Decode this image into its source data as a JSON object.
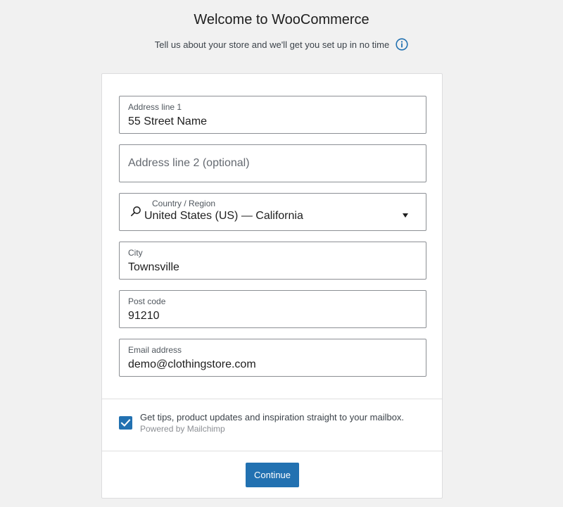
{
  "header": {
    "title": "Welcome to WooCommerce",
    "subtitle": "Tell us about your store and we'll get you set up in no time",
    "info_icon": "info-icon"
  },
  "form": {
    "address1": {
      "label": "Address line 1",
      "value": "55 Street Name"
    },
    "address2": {
      "placeholder": "Address line 2 (optional)",
      "value": ""
    },
    "country": {
      "label": "Country / Region",
      "value": "United States (US) — California",
      "icon": "search-icon"
    },
    "city": {
      "label": "City",
      "value": "Townsville"
    },
    "postcode": {
      "label": "Post code",
      "value": "91210"
    },
    "email": {
      "label": "Email address",
      "value": "demo@clothingstore.com"
    }
  },
  "optin": {
    "checked": true,
    "text": "Get tips, product updates and inspiration straight to your mailbox.",
    "powered_by": "Powered by Mailchimp"
  },
  "actions": {
    "continue_label": "Continue"
  },
  "colors": {
    "primary": "#2271b1",
    "border": "#8c8f94",
    "background": "#f1f1f1"
  }
}
